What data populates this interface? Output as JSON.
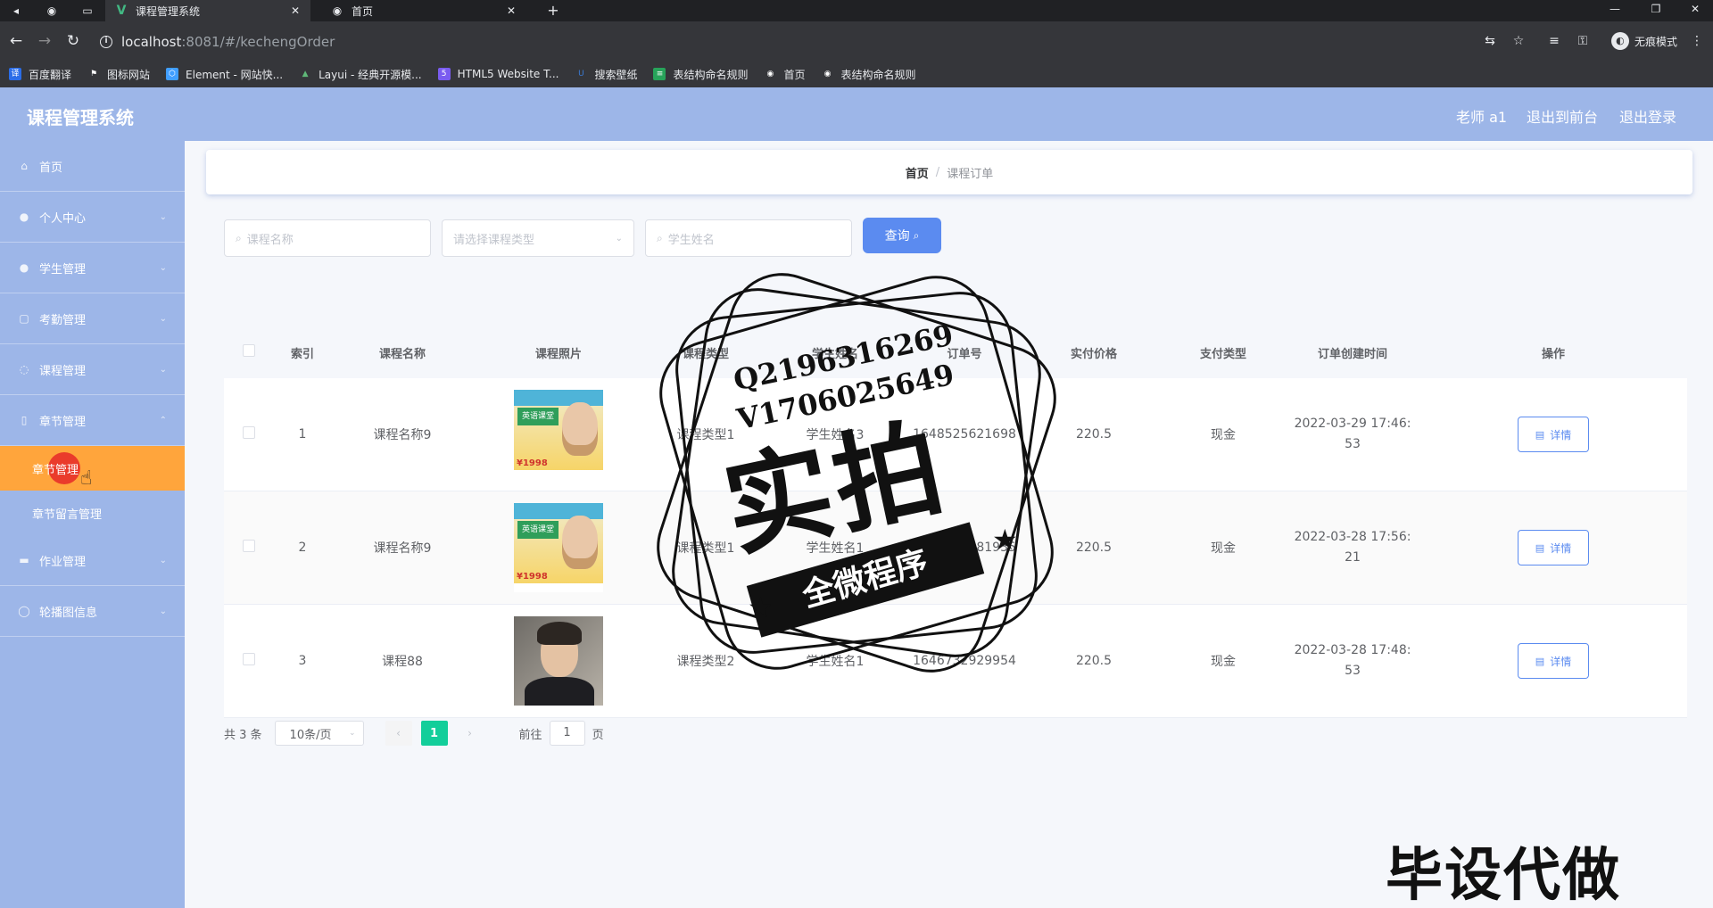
{
  "browser": {
    "tabs": [
      {
        "label": "课程管理系统",
        "active": true,
        "favicon": "vue-logo-icon"
      },
      {
        "label": "首页",
        "active": false,
        "favicon": "globe-icon"
      }
    ],
    "new_tab": "+",
    "url_host": "localhost",
    "url_path": ":8081/#/kechengOrder",
    "incognito_label": "无痕模式",
    "bookmarks": [
      {
        "label": "百度翻译",
        "color": "#2b6de8"
      },
      {
        "label": "图标网站",
        "color": "#ffffff"
      },
      {
        "label": "Element - 网站快...",
        "color": "#409eff"
      },
      {
        "label": "Layui - 经典开源模...",
        "color": "#5fb878"
      },
      {
        "label": "HTML5 Website T...",
        "color": "#7a5cf0"
      },
      {
        "label": "搜索壁纸",
        "color": "#3a7bd5"
      },
      {
        "label": "表结构命名规则",
        "color": "#27a35a"
      },
      {
        "label": "首页",
        "color": "#e8eaed"
      },
      {
        "label": "表结构命名规则",
        "color": "#e8eaed"
      }
    ]
  },
  "header": {
    "title": "课程管理系统",
    "user": "老师 a1",
    "to_front": "退出到前台",
    "logout": "退出登录"
  },
  "sidebar": {
    "items_top": [
      {
        "label": "首页",
        "icon": "home-icon"
      },
      {
        "label": "个人中心",
        "icon": "user-icon"
      },
      {
        "label": "学生管理",
        "icon": "user-icon"
      },
      {
        "label": "考勤管理",
        "icon": "calendar-icon"
      },
      {
        "label": "课程管理",
        "icon": "book-icon"
      },
      {
        "label": "章节管理",
        "icon": "phone-icon"
      }
    ],
    "sub_items": [
      {
        "label": "章节管理",
        "active": true
      },
      {
        "label": "章节留言管理",
        "active": false
      }
    ],
    "items_bottom": [
      {
        "label": "作业管理",
        "icon": "folder-icon"
      },
      {
        "label": "轮播图信息",
        "icon": "image-icon"
      }
    ]
  },
  "breadcrumb": {
    "home": "首页",
    "separator": "/",
    "current": "课程订单"
  },
  "search": {
    "course_name_placeholder": "课程名称",
    "course_type_placeholder": "请选择课程类型",
    "student_name_placeholder": "学生姓名",
    "query_button": "查询"
  },
  "table": {
    "columns": [
      "索引",
      "课程名称",
      "课程照片",
      "课程类型",
      "学生姓名",
      "订单号",
      "实付价格",
      "支付类型",
      "订单创建时间",
      "操作"
    ],
    "rows": [
      {
        "index": "1",
        "course": "课程名称9",
        "photo": "poster",
        "type": "课程类型1",
        "student": "学生姓名3",
        "order": "1648525621698",
        "price": "220.5",
        "pay": "现金",
        "time_line1": "2022-03-29 17:46:",
        "time_line2": "53",
        "action": "详情"
      },
      {
        "index": "2",
        "course": "课程名称9",
        "photo": "poster",
        "type": "课程类型1",
        "student": "学生姓名1",
        "order": "1648461381935",
        "price": "220.5",
        "pay": "现金",
        "time_line1": "2022-03-28 17:56:",
        "time_line2": "21",
        "action": "详情"
      },
      {
        "index": "3",
        "course": "课程88",
        "photo": "person",
        "type": "课程类型2",
        "student": "学生姓名1",
        "order": "1646732929954",
        "price": "220.5",
        "pay": "现金",
        "time_line1": "2022-03-28 17:48:",
        "time_line2": "53",
        "action": "详情"
      }
    ]
  },
  "poster": {
    "title": "英语课堂",
    "price": "¥1998"
  },
  "pagination": {
    "total": "共 3 条",
    "page_size": "10条/页",
    "prev": "‹",
    "current": "1",
    "next": "›",
    "goto_label": "前往",
    "goto_value": "1",
    "page_suffix": "页"
  },
  "watermark": {
    "qq": "Q2196316269",
    "vx": "V1706025649",
    "big": "实拍",
    "band": "全微程序",
    "corner": "毕设代做"
  }
}
